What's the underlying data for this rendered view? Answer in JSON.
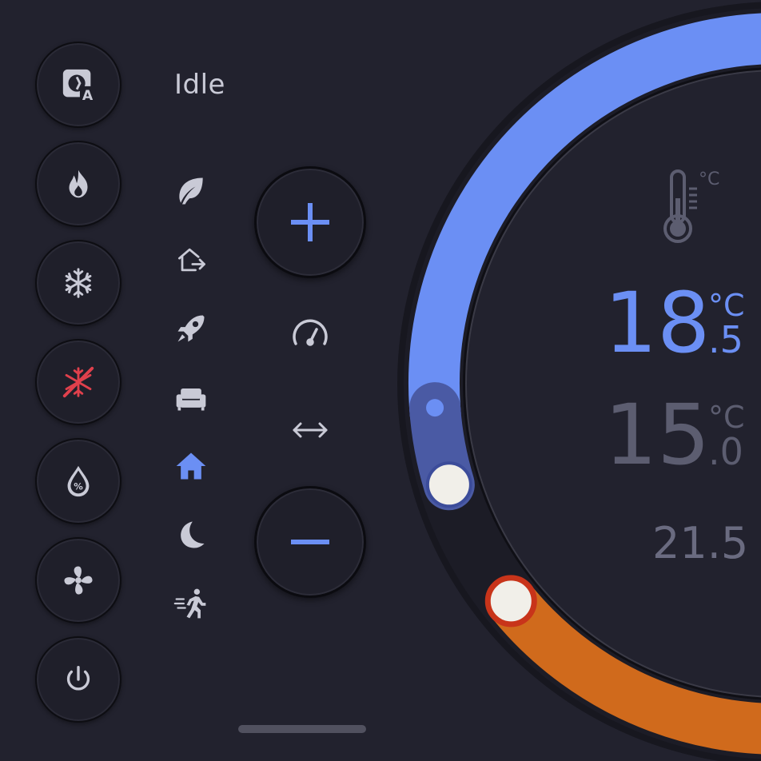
{
  "status": "Idle",
  "modes": [
    {
      "name": "auto",
      "icon": "thermostat-auto-icon",
      "active": false
    },
    {
      "name": "heat",
      "icon": "fire-icon",
      "active": false
    },
    {
      "name": "cool",
      "icon": "snowflake-icon",
      "active": false
    },
    {
      "name": "off-cool",
      "icon": "snowflake-off-icon",
      "active": true
    },
    {
      "name": "dry",
      "icon": "water-percent-icon",
      "active": false
    },
    {
      "name": "fan",
      "icon": "fan-icon",
      "active": false
    },
    {
      "name": "power",
      "icon": "power-icon",
      "active": false
    }
  ],
  "presets": [
    {
      "name": "eco",
      "icon": "leaf-icon",
      "active": false
    },
    {
      "name": "away",
      "icon": "home-export-icon",
      "active": false
    },
    {
      "name": "boost",
      "icon": "rocket-icon",
      "active": false
    },
    {
      "name": "comfort",
      "icon": "sofa-icon",
      "active": false
    },
    {
      "name": "home",
      "icon": "home-icon",
      "active": true
    },
    {
      "name": "sleep",
      "icon": "moon-icon",
      "active": false
    },
    {
      "name": "activity",
      "icon": "run-icon",
      "active": false
    }
  ],
  "controls": {
    "plus_label": "+",
    "minus_label": "−",
    "speed_icon": "speedometer-icon",
    "range_icon": "arrow-horizontal-icon"
  },
  "dial": {
    "low_setpoint": {
      "int": "15",
      "dec": ".0",
      "unit": "°C"
    },
    "high_setpoint": {
      "int": "18",
      "dec": ".5",
      "unit": "°C"
    },
    "current": "21.5",
    "thermometer_unit": "°C"
  },
  "colors": {
    "cool": "#6b8ff4",
    "cool_dim": "#4a5aa4",
    "heat": "#d06a1c",
    "heat_ring": "#c8341a",
    "active_alert": "#e0404c",
    "active_preset": "#6b8ff4",
    "icon": "#c9cad6",
    "muted": "#6a6b80"
  }
}
